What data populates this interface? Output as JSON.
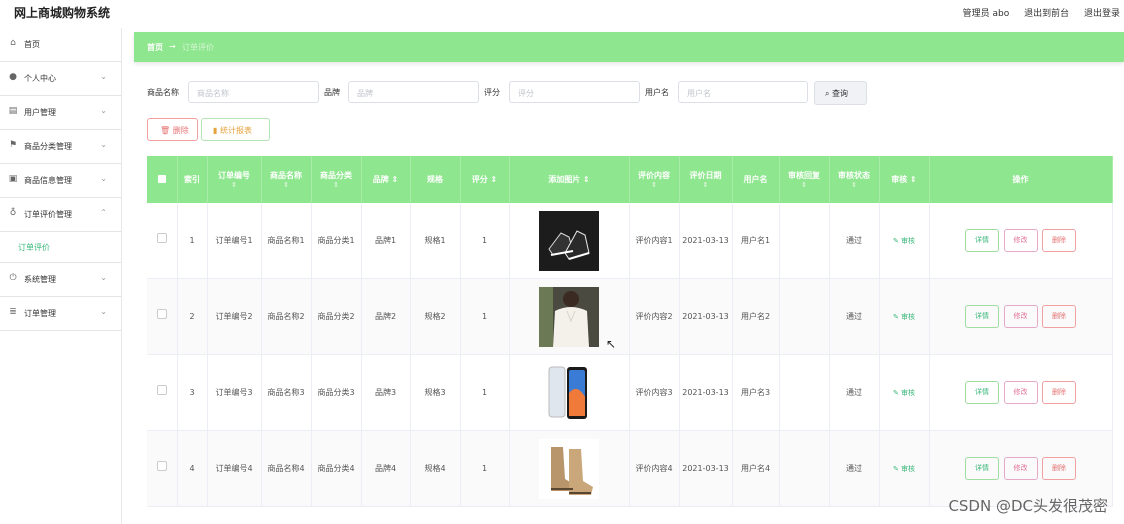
{
  "app": {
    "title": "网上商城购物系统"
  },
  "topnav": {
    "admin": "管理员 abo",
    "to_front": "退出到前台",
    "logout": "退出登录"
  },
  "sidebar": {
    "items": [
      {
        "label": "首页",
        "icon": "home-icon"
      },
      {
        "label": "个人中心",
        "icon": "user-icon"
      },
      {
        "label": "用户管理",
        "icon": "users-icon"
      },
      {
        "label": "商品分类管理",
        "icon": "flag-icon"
      },
      {
        "label": "商品信息管理",
        "icon": "info-icon"
      },
      {
        "label": "订单评价管理",
        "icon": "mic-icon"
      },
      {
        "label": "系统管理",
        "icon": "power-icon"
      },
      {
        "label": "订单管理",
        "icon": "list-icon"
      }
    ],
    "sub_item": "订单评价"
  },
  "breadcrumb": {
    "home": "首页",
    "current": "订单评价"
  },
  "filters": {
    "name_label": "商品名称",
    "name_placeholder": "商品名称",
    "brand_label": "品牌",
    "brand_placeholder": "品牌",
    "score_label": "评分",
    "score_placeholder": "评分",
    "user_label": "用户名",
    "user_placeholder": "用户名",
    "query_button": "查询"
  },
  "actions": {
    "delete": "删除",
    "stats": "统计报表"
  },
  "table": {
    "headers": [
      "索引",
      "订单编号",
      "商品名称",
      "商品分类",
      "品牌",
      "规格",
      "评分",
      "添加图片",
      "评价内容",
      "评价日期",
      "用户名",
      "审核回复",
      "审核状态",
      "审核",
      "操作"
    ],
    "rows": [
      {
        "index": "1",
        "order": "订单编号1",
        "name": "商品名称1",
        "category": "商品分类1",
        "brand": "品牌1",
        "spec": "规格1",
        "score": "1",
        "content": "评价内容1",
        "date": "2021-03-13",
        "user": "用户名1",
        "reply": "",
        "status": "通过",
        "audit": "审核",
        "image": "shoes"
      },
      {
        "index": "2",
        "order": "订单编号2",
        "name": "商品名称2",
        "category": "商品分类2",
        "brand": "品牌2",
        "spec": "规格2",
        "score": "1",
        "content": "评价内容2",
        "date": "2021-03-13",
        "user": "用户名2",
        "reply": "",
        "status": "通过",
        "audit": "审核",
        "image": "blouse"
      },
      {
        "index": "3",
        "order": "订单编号3",
        "name": "商品名称3",
        "category": "商品分类3",
        "brand": "品牌3",
        "spec": "规格3",
        "score": "1",
        "content": "评价内容3",
        "date": "2021-03-13",
        "user": "用户名3",
        "reply": "",
        "status": "通过",
        "audit": "审核",
        "image": "phone"
      },
      {
        "index": "4",
        "order": "订单编号4",
        "name": "商品名称4",
        "category": "商品分类4",
        "brand": "品牌4",
        "spec": "规格4",
        "score": "1",
        "content": "评价内容4",
        "date": "2021-03-13",
        "user": "用户名4",
        "reply": "",
        "status": "通过",
        "audit": "审核",
        "image": "boots"
      }
    ],
    "ops": {
      "detail": "详情",
      "edit": "修改",
      "delete": "删除"
    }
  },
  "watermark": "CSDN @DC头发很茂密",
  "colors": {
    "accent": "#8ee68e",
    "accent_text": "#3ab77a"
  }
}
